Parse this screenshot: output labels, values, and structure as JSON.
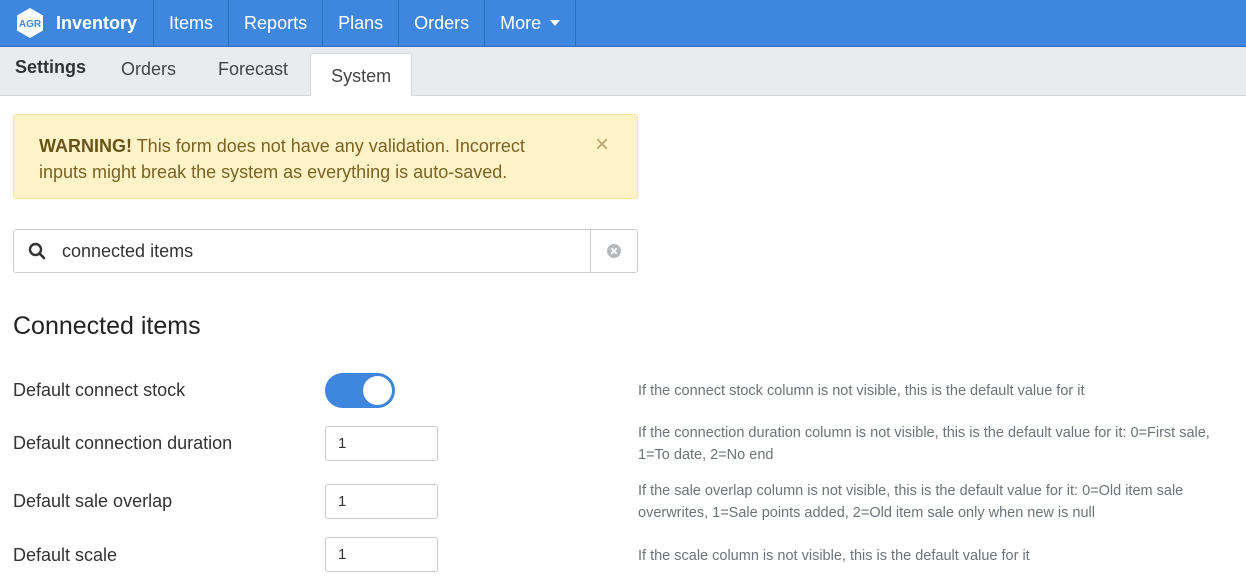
{
  "navbar": {
    "logo_text": "AGR",
    "brand": "Inventory",
    "items": [
      "Items",
      "Reports",
      "Plans",
      "Orders"
    ],
    "more_label": "More"
  },
  "subnav": {
    "title": "Settings",
    "tabs": [
      "Orders",
      "Forecast",
      "System"
    ],
    "active_tab": "System"
  },
  "alert": {
    "strong": "WARNING!",
    "message": "This form does not have any validation. Incorrect inputs might break the system as everything is auto-saved.",
    "close": "×"
  },
  "search": {
    "value": "connected items",
    "icon": "search-icon",
    "clear_icon": "clear-icon"
  },
  "section": {
    "title": "Connected items",
    "rows": [
      {
        "label": "Default connect stock",
        "type": "toggle",
        "value": true,
        "description": "If the connect stock column is not visible, this is the default value for it"
      },
      {
        "label": "Default connection duration",
        "type": "number",
        "value": "1",
        "description": "If the connection duration column is not visible, this is the default value for it: 0=First sale, 1=To date, 2=No end"
      },
      {
        "label": "Default sale overlap",
        "type": "number",
        "value": "1",
        "description": "If the sale overlap column is not visible, this is the default value for it: 0=Old item sale overwrites, 1=Sale points added, 2=Old item sale only when new is null"
      },
      {
        "label": "Default scale",
        "type": "number",
        "value": "1",
        "description": "If the scale column is not visible, this is the default value for it"
      }
    ]
  },
  "colors": {
    "brand_blue": "#3f87de",
    "alert_bg": "#fdf2c8",
    "alert_text": "#7a6323"
  }
}
